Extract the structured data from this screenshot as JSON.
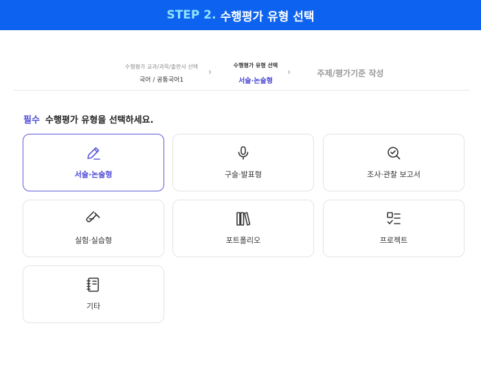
{
  "header": {
    "step_label": "STEP 2.",
    "title": "수행평가 유형 선택"
  },
  "stepper": {
    "step1": {
      "caption": "수행평가 교과/과목/출판사 선택",
      "value": "국어 / 공통국어1"
    },
    "step2": {
      "caption": "수행평가 유형 선택",
      "value": "서술·논술형"
    },
    "step3": {
      "label": "주제/평가기준 작성"
    },
    "chevron": "›"
  },
  "section": {
    "required": "필수",
    "title": "수행평가 유형을 선택하세요."
  },
  "types": [
    {
      "label": "서술·논술형",
      "icon": "pencil-icon",
      "selected": true
    },
    {
      "label": "구술·발표형",
      "icon": "microphone-icon",
      "selected": false
    },
    {
      "label": "조사·관찰 보고서",
      "icon": "magnifier-check-icon",
      "selected": false
    },
    {
      "label": "실험·실습형",
      "icon": "test-tube-icon",
      "selected": false
    },
    {
      "label": "포트폴리오",
      "icon": "books-icon",
      "selected": false
    },
    {
      "label": "프로젝트",
      "icon": "checklist-icon",
      "selected": false
    },
    {
      "label": "기타",
      "icon": "notebook-icon",
      "selected": false
    }
  ],
  "colors": {
    "header_bg": "#0d63f0",
    "step_accent": "#8fe3ff",
    "accent": "#4d49d6"
  }
}
